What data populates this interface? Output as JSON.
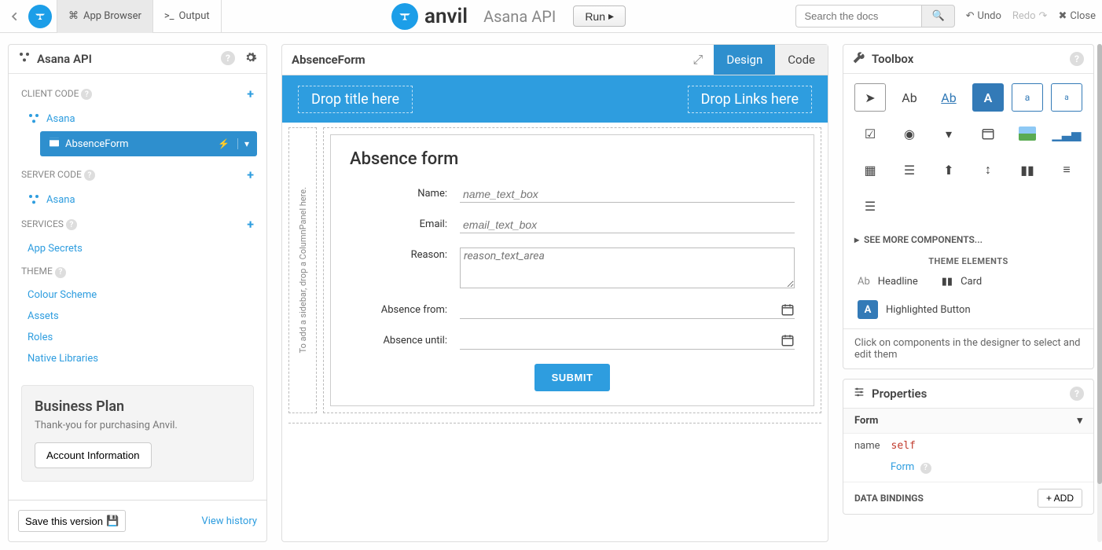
{
  "topbar": {
    "app_browser_label": "App Browser",
    "output_label": "Output",
    "brand": "anvil",
    "app_title": "Asana API",
    "run_label": "Run",
    "search_placeholder": "Search the docs",
    "undo_label": "Undo",
    "redo_label": "Redo",
    "close_label": "Close"
  },
  "sidebar": {
    "title": "Asana API",
    "sections": {
      "client_code": "CLIENT CODE",
      "server_code": "SERVER CODE",
      "services": "SERVICES",
      "theme": "THEME"
    },
    "client_items": {
      "asana": "Asana",
      "absence_form": "AbsenceForm"
    },
    "server_items": {
      "asana": "Asana"
    },
    "service_items": {
      "app_secrets": "App Secrets"
    },
    "theme_items": {
      "colour_scheme": "Colour Scheme",
      "assets": "Assets",
      "roles": "Roles",
      "native_libraries": "Native Libraries"
    },
    "business_plan": {
      "title": "Business Plan",
      "subtitle": "Thank-you for purchasing Anvil.",
      "button": "Account Information"
    },
    "footer": {
      "save_version": "Save this version",
      "view_history": "View history"
    }
  },
  "designer": {
    "form_name": "AbsenceForm",
    "tab_design": "Design",
    "tab_code": "Code",
    "drop_title": "Drop title here",
    "drop_links": "Drop Links here",
    "sidebar_drop": "To add a sidebar, drop a ColumnPanel here.",
    "form": {
      "heading": "Absence form",
      "labels": {
        "name": "Name:",
        "email": "Email:",
        "reason": "Reason:",
        "absence_from": "Absence from:",
        "absence_until": "Absence until:"
      },
      "placeholders": {
        "name": "name_text_box",
        "email": "email_text_box",
        "reason": "reason_text_area"
      },
      "submit": "SUBMIT"
    }
  },
  "toolbox": {
    "title": "Toolbox",
    "see_more": "SEE MORE COMPONENTS...",
    "theme_elements_hdr": "THEME ELEMENTS",
    "theme_headline": "Headline",
    "theme_card": "Card",
    "theme_highlighted": "Highlighted Button",
    "helper": "Click on components in the designer to select and edit them",
    "items": {
      "label_text": "Ab",
      "link_text": "Ab",
      "button_text": "A",
      "textbox_text": "a",
      "textarea_text": "a"
    }
  },
  "properties": {
    "title": "Properties",
    "section": "Form",
    "name_key": "name",
    "name_val": "self",
    "type_link": "Form",
    "databindings": "DATA BINDINGS",
    "add": "+ ADD"
  }
}
